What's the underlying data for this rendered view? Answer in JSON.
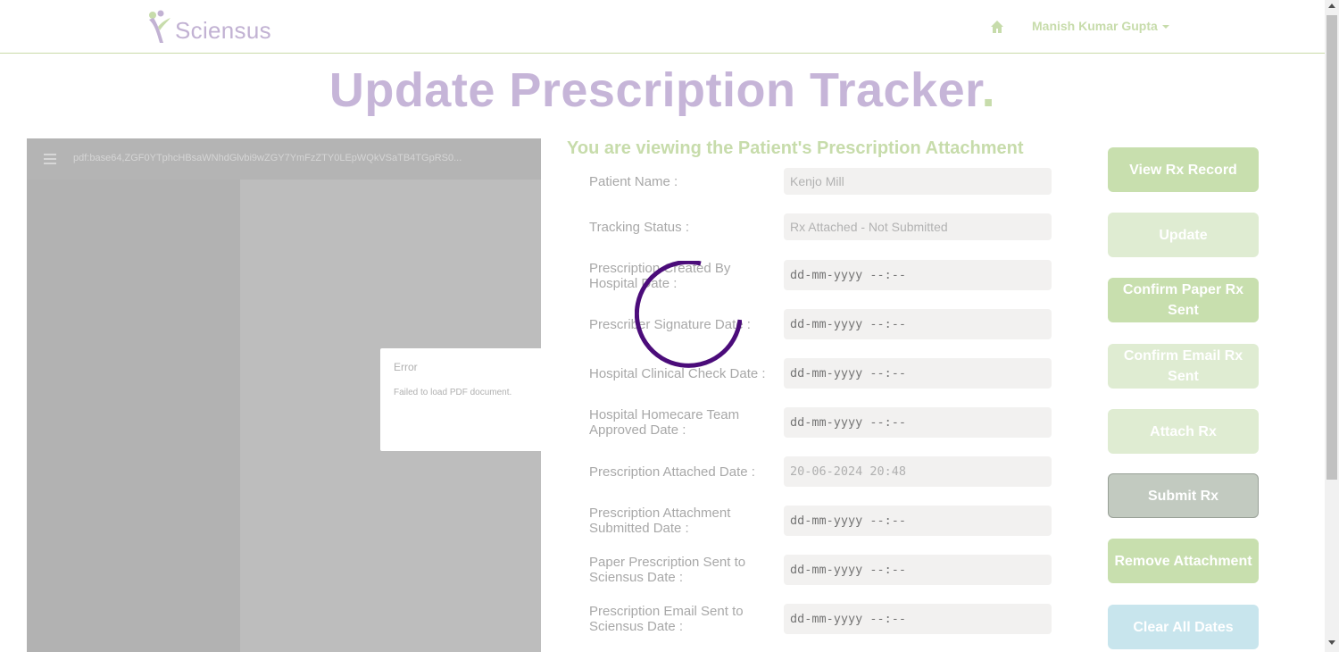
{
  "header": {
    "logo_text": "Sciensus",
    "user_name": "Manish Kumar Gupta"
  },
  "page": {
    "title": "Update Prescription Tracker",
    "title_dot": "."
  },
  "pdf_viewer": {
    "url": "pdf:base64,ZGF0YTphcHBsaWNhdGlvbi9wZGY7YmFzZTY0LEpWQkVSaTB4TGpRS0...",
    "error_title": "Error",
    "error_message": "Failed to load PDF document."
  },
  "form": {
    "heading": "You are viewing the Patient's Prescription Attachment",
    "patient_name_label": "Patient Name :",
    "patient_name_value": "Kenjo Mill",
    "tracking_status_label": "Tracking Status :",
    "tracking_status_value": "Rx Attached - Not Submitted",
    "date_placeholder": "dd-mm-yyyy --:--",
    "fields": [
      {
        "label": "Prescription Created By Hospital Date :",
        "value": ""
      },
      {
        "label": "Prescriber Signature Date :",
        "value": ""
      },
      {
        "label": "Hospital Clinical Check Date :",
        "value": ""
      },
      {
        "label": "Hospital Homecare Team Approved Date :",
        "value": ""
      },
      {
        "label": "Prescription Attached Date :",
        "value": "20-06-2024 20:48"
      },
      {
        "label": "Prescription Attachment Submitted Date :",
        "value": ""
      },
      {
        "label": "Paper Prescription Sent to Sciensus Date :",
        "value": ""
      },
      {
        "label": "Prescription Email Sent to Sciensus Date :",
        "value": ""
      }
    ]
  },
  "actions": {
    "view_rx_record": "View Rx Record",
    "update": "Update",
    "confirm_paper_rx_sent": "Confirm Paper Rx Sent",
    "confirm_email_rx_sent": "Confirm Email Rx Sent",
    "attach_rx": "Attach Rx",
    "submit_rx": "Submit Rx",
    "remove_attachment": "Remove Attachment",
    "clear_all_dates": "Clear All Dates"
  },
  "colors": {
    "brand_purple": "#c6b5d8",
    "brand_green": "#c7dcab",
    "spinner": "#4b0c7a"
  }
}
